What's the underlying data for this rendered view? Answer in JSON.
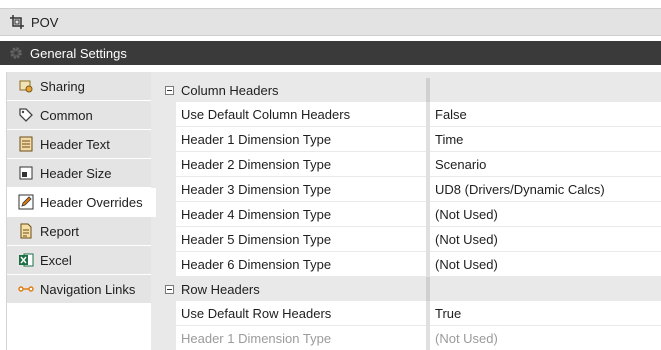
{
  "pov": {
    "title": "POV",
    "icon": "pov-crop-icon"
  },
  "general_settings": {
    "title": "General Settings",
    "icon": "gear-icon"
  },
  "sidebar": {
    "items": [
      {
        "label": "Sharing",
        "icon": "sharing-icon",
        "active": false
      },
      {
        "label": "Common",
        "icon": "tag-icon",
        "active": false
      },
      {
        "label": "Header Text",
        "icon": "document-text-icon",
        "active": false
      },
      {
        "label": "Header Size",
        "icon": "resize-icon",
        "active": false
      },
      {
        "label": "Header Overrides",
        "icon": "edit-icon",
        "active": true
      },
      {
        "label": "Report",
        "icon": "report-icon",
        "active": false
      },
      {
        "label": "Excel",
        "icon": "excel-icon",
        "active": false
      },
      {
        "label": "Navigation Links",
        "icon": "link-icon",
        "active": false
      }
    ]
  },
  "properties": {
    "column_headers": {
      "title": "Column Headers",
      "rows": [
        {
          "name": "Use Default Column Headers",
          "value": "False"
        },
        {
          "name": "Header 1 Dimension Type",
          "value": "Time"
        },
        {
          "name": "Header 2 Dimension Type",
          "value": "Scenario"
        },
        {
          "name": "Header 3 Dimension Type",
          "value": "UD8 (Drivers/Dynamic Calcs)"
        },
        {
          "name": "Header 4 Dimension Type",
          "value": "(Not Used)"
        },
        {
          "name": "Header 5 Dimension Type",
          "value": "(Not Used)"
        },
        {
          "name": "Header 6 Dimension Type",
          "value": "(Not Used)"
        }
      ]
    },
    "row_headers": {
      "title": "Row Headers",
      "rows": [
        {
          "name": "Use Default Row Headers",
          "value": "True"
        },
        {
          "name": "Header 1 Dimension Type",
          "value": "(Not Used)"
        }
      ]
    }
  },
  "colors": {
    "excel_green": "#1d7044",
    "accent_orange": "#e07a10",
    "dark_bar": "#3a3a3a"
  }
}
